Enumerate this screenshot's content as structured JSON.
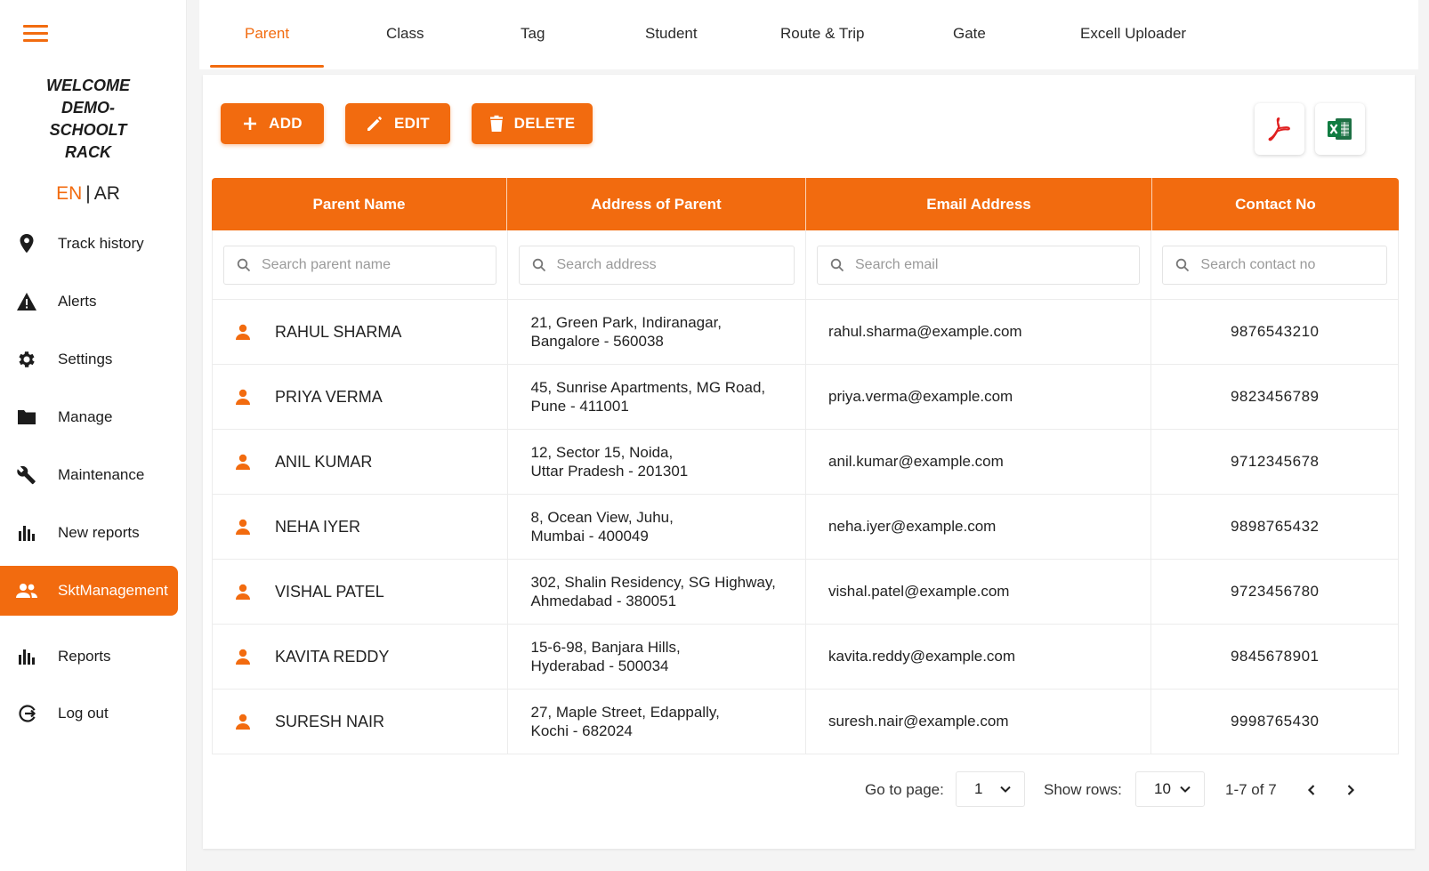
{
  "sidebar": {
    "welcome_lines": [
      "WELCOME",
      "DEMO-",
      "SCHOOLT",
      "RACK"
    ],
    "lang_en": "EN",
    "lang_sep": "|",
    "lang_ar": "AR",
    "items": [
      {
        "label": "Track history",
        "icon": "location-pin-icon"
      },
      {
        "label": "Alerts",
        "icon": "warning-icon"
      },
      {
        "label": "Settings",
        "icon": "gear-icon"
      },
      {
        "label": "Manage",
        "icon": "folder-icon"
      },
      {
        "label": "Maintenance",
        "icon": "wrench-icon"
      },
      {
        "label": "New reports",
        "icon": "bar-chart-icon"
      },
      {
        "label": "SktManagement",
        "icon": "people-icon",
        "active": true
      },
      {
        "label": "Reports",
        "icon": "bar-chart-icon"
      },
      {
        "label": "Log out",
        "icon": "logout-icon"
      }
    ]
  },
  "tabs": [
    {
      "label": "Parent",
      "active": true
    },
    {
      "label": "Class"
    },
    {
      "label": "Tag"
    },
    {
      "label": "Student"
    },
    {
      "label": "Route & Trip"
    },
    {
      "label": "Gate"
    },
    {
      "label": "Excell Uploader"
    }
  ],
  "toolbar": {
    "add_label": "ADD",
    "edit_label": "EDIT",
    "delete_label": "DELETE"
  },
  "table": {
    "headers": [
      "Parent Name",
      "Address of Parent",
      "Email Address",
      "Contact No"
    ],
    "search_placeholders": [
      "Search parent name",
      "Search address",
      "Search email",
      "Search contact no"
    ],
    "rows": [
      {
        "name": "RAHUL SHARMA",
        "addr1": "21, Green Park, Indiranagar,",
        "addr2": "Bangalore - 560038",
        "email": "rahul.sharma@example.com",
        "phone": "9876543210"
      },
      {
        "name": "PRIYA VERMA",
        "addr1": "45, Sunrise Apartments, MG Road,",
        "addr2": "Pune - 411001",
        "email": "priya.verma@example.com",
        "phone": "9823456789"
      },
      {
        "name": "ANIL KUMAR",
        "addr1": "12, Sector 15, Noida,",
        "addr2": "Uttar Pradesh - 201301",
        "email": "anil.kumar@example.com",
        "phone": "9712345678"
      },
      {
        "name": "NEHA IYER",
        "addr1": "8, Ocean View, Juhu,",
        "addr2": "Mumbai - 400049",
        "email": "neha.iyer@example.com",
        "phone": "9898765432"
      },
      {
        "name": "VISHAL PATEL",
        "addr1": "302, Shalin Residency, SG Highway,",
        "addr2": "Ahmedabad - 380051",
        "email": "vishal.patel@example.com",
        "phone": "9723456780"
      },
      {
        "name": "KAVITA REDDY",
        "addr1": "15-6-98, Banjara Hills,",
        "addr2": "Hyderabad - 500034",
        "email": "kavita.reddy@example.com",
        "phone": "9845678901"
      },
      {
        "name": "SURESH NAIR",
        "addr1": "27, Maple Street, Edappally,",
        "addr2": "Kochi - 682024",
        "email": "suresh.nair@example.com",
        "phone": "9998765430"
      }
    ]
  },
  "pagination": {
    "goto_label": "Go to page:",
    "page_value": "1",
    "rows_label": "Show rows:",
    "rows_value": "10",
    "range_text": "1-7 of 7"
  },
  "colors": {
    "accent": "#f26b0f",
    "excel": "#1d7044",
    "pdf": "#e02020"
  }
}
